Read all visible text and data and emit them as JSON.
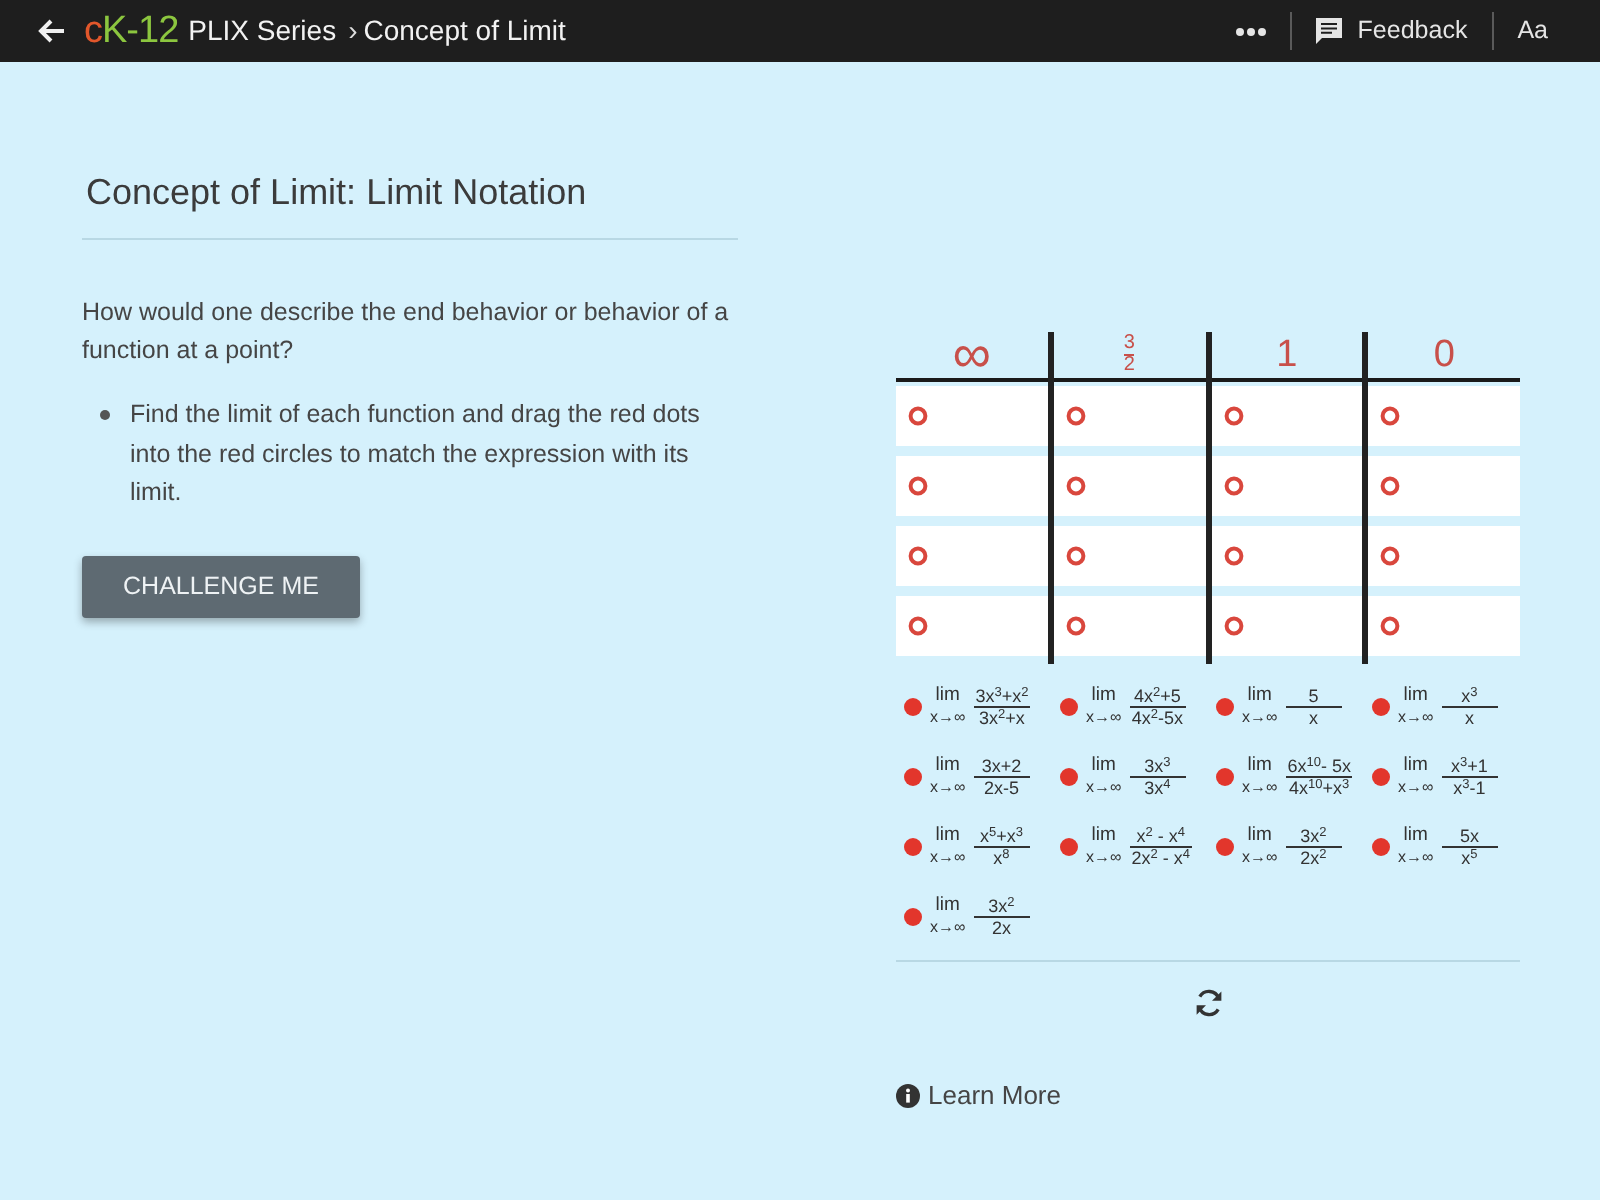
{
  "header": {
    "logo": [
      {
        "text": "c",
        "color": "#e2572b"
      },
      {
        "text": "K-12",
        "color": "#8cc63f"
      }
    ],
    "breadcrumb": {
      "section": "PLIX Series",
      "separator": "›",
      "page": "Concept of Limit"
    },
    "actions": [
      {
        "kind": "more"
      },
      {
        "kind": "feedback",
        "label": "Feedback"
      },
      {
        "kind": "text",
        "label": "Aa"
      }
    ]
  },
  "lesson": {
    "title": "Concept of Limit: Limit Notation",
    "question": "How would one describe the end behavior or behavior of a function at a point?",
    "instructions": [
      "Find the limit of each function and drag the red dots into the red circles to match the expression with its limit."
    ],
    "button": "CHALLENGE ME",
    "link": "Learn More"
  },
  "activity": {
    "columns": [
      {
        "kind": "symbol",
        "label": "∞",
        "slots": [
          {
            "filled": false
          },
          {
            "filled": false
          },
          {
            "filled": false
          },
          {
            "filled": false
          }
        ]
      },
      {
        "kind": "fraction",
        "numerator": "3",
        "denominator": "2",
        "slots": [
          {
            "filled": false
          },
          {
            "filled": false
          },
          {
            "filled": false
          },
          {
            "filled": false
          }
        ]
      },
      {
        "kind": "number",
        "label": "1",
        "slots": [
          {
            "filled": false
          },
          {
            "filled": false
          },
          {
            "filled": false
          },
          {
            "filled": false
          }
        ]
      },
      {
        "kind": "number",
        "label": "0",
        "slots": [
          {
            "filled": false
          },
          {
            "filled": false
          },
          {
            "filled": false
          },
          {
            "filled": false
          }
        ]
      }
    ],
    "expressions": [
      {
        "operator": "lim",
        "approach": "x→∞",
        "numerator": "3x$^{3}$+x$^{2}$",
        "denominator": "3x$^{2}$+x"
      },
      {
        "operator": "lim",
        "approach": "x→∞",
        "numerator": "4x$^{2}$+5",
        "denominator": "4x$^{2}$-5x"
      },
      {
        "operator": "lim",
        "approach": "x→∞",
        "numerator": "5",
        "denominator": "x"
      },
      {
        "operator": "lim",
        "approach": "x→∞",
        "numerator": "x$^{3}$",
        "denominator": "x"
      },
      {
        "operator": "lim",
        "approach": "x→∞",
        "numerator": "3x+2",
        "denominator": "2x-5"
      },
      {
        "operator": "lim",
        "approach": "x→∞",
        "numerator": "3x$^{3}$",
        "denominator": "3x$^{4}$"
      },
      {
        "operator": "lim",
        "approach": "x→∞",
        "numerator": "6x$^{10}$- 5x",
        "denominator": "4x$^{10}$+x$^{3}$"
      },
      {
        "operator": "lim",
        "approach": "x→∞",
        "numerator": "x$^{3}$+1",
        "denominator": "x$^{3}$-1"
      },
      {
        "operator": "lim",
        "approach": "x→∞",
        "numerator": "x$^{5}$+x$^{3}$",
        "denominator": "x$^{8}$"
      },
      {
        "operator": "lim",
        "approach": "x→∞",
        "numerator": "x$^{2}$ - x$^{4}$",
        "denominator": "2x$^{2}$ - x$^{4}$"
      },
      {
        "operator": "lim",
        "approach": "x→∞",
        "numerator": "3x$^{2}$",
        "denominator": "2x$^{2}$"
      },
      {
        "operator": "lim",
        "approach": "x→∞",
        "numerator": "5x",
        "denominator": "x$^{5}$"
      },
      {
        "operator": "lim",
        "approach": "x→∞",
        "numerator": "3x$^{2}$",
        "denominator": "2x"
      }
    ]
  }
}
